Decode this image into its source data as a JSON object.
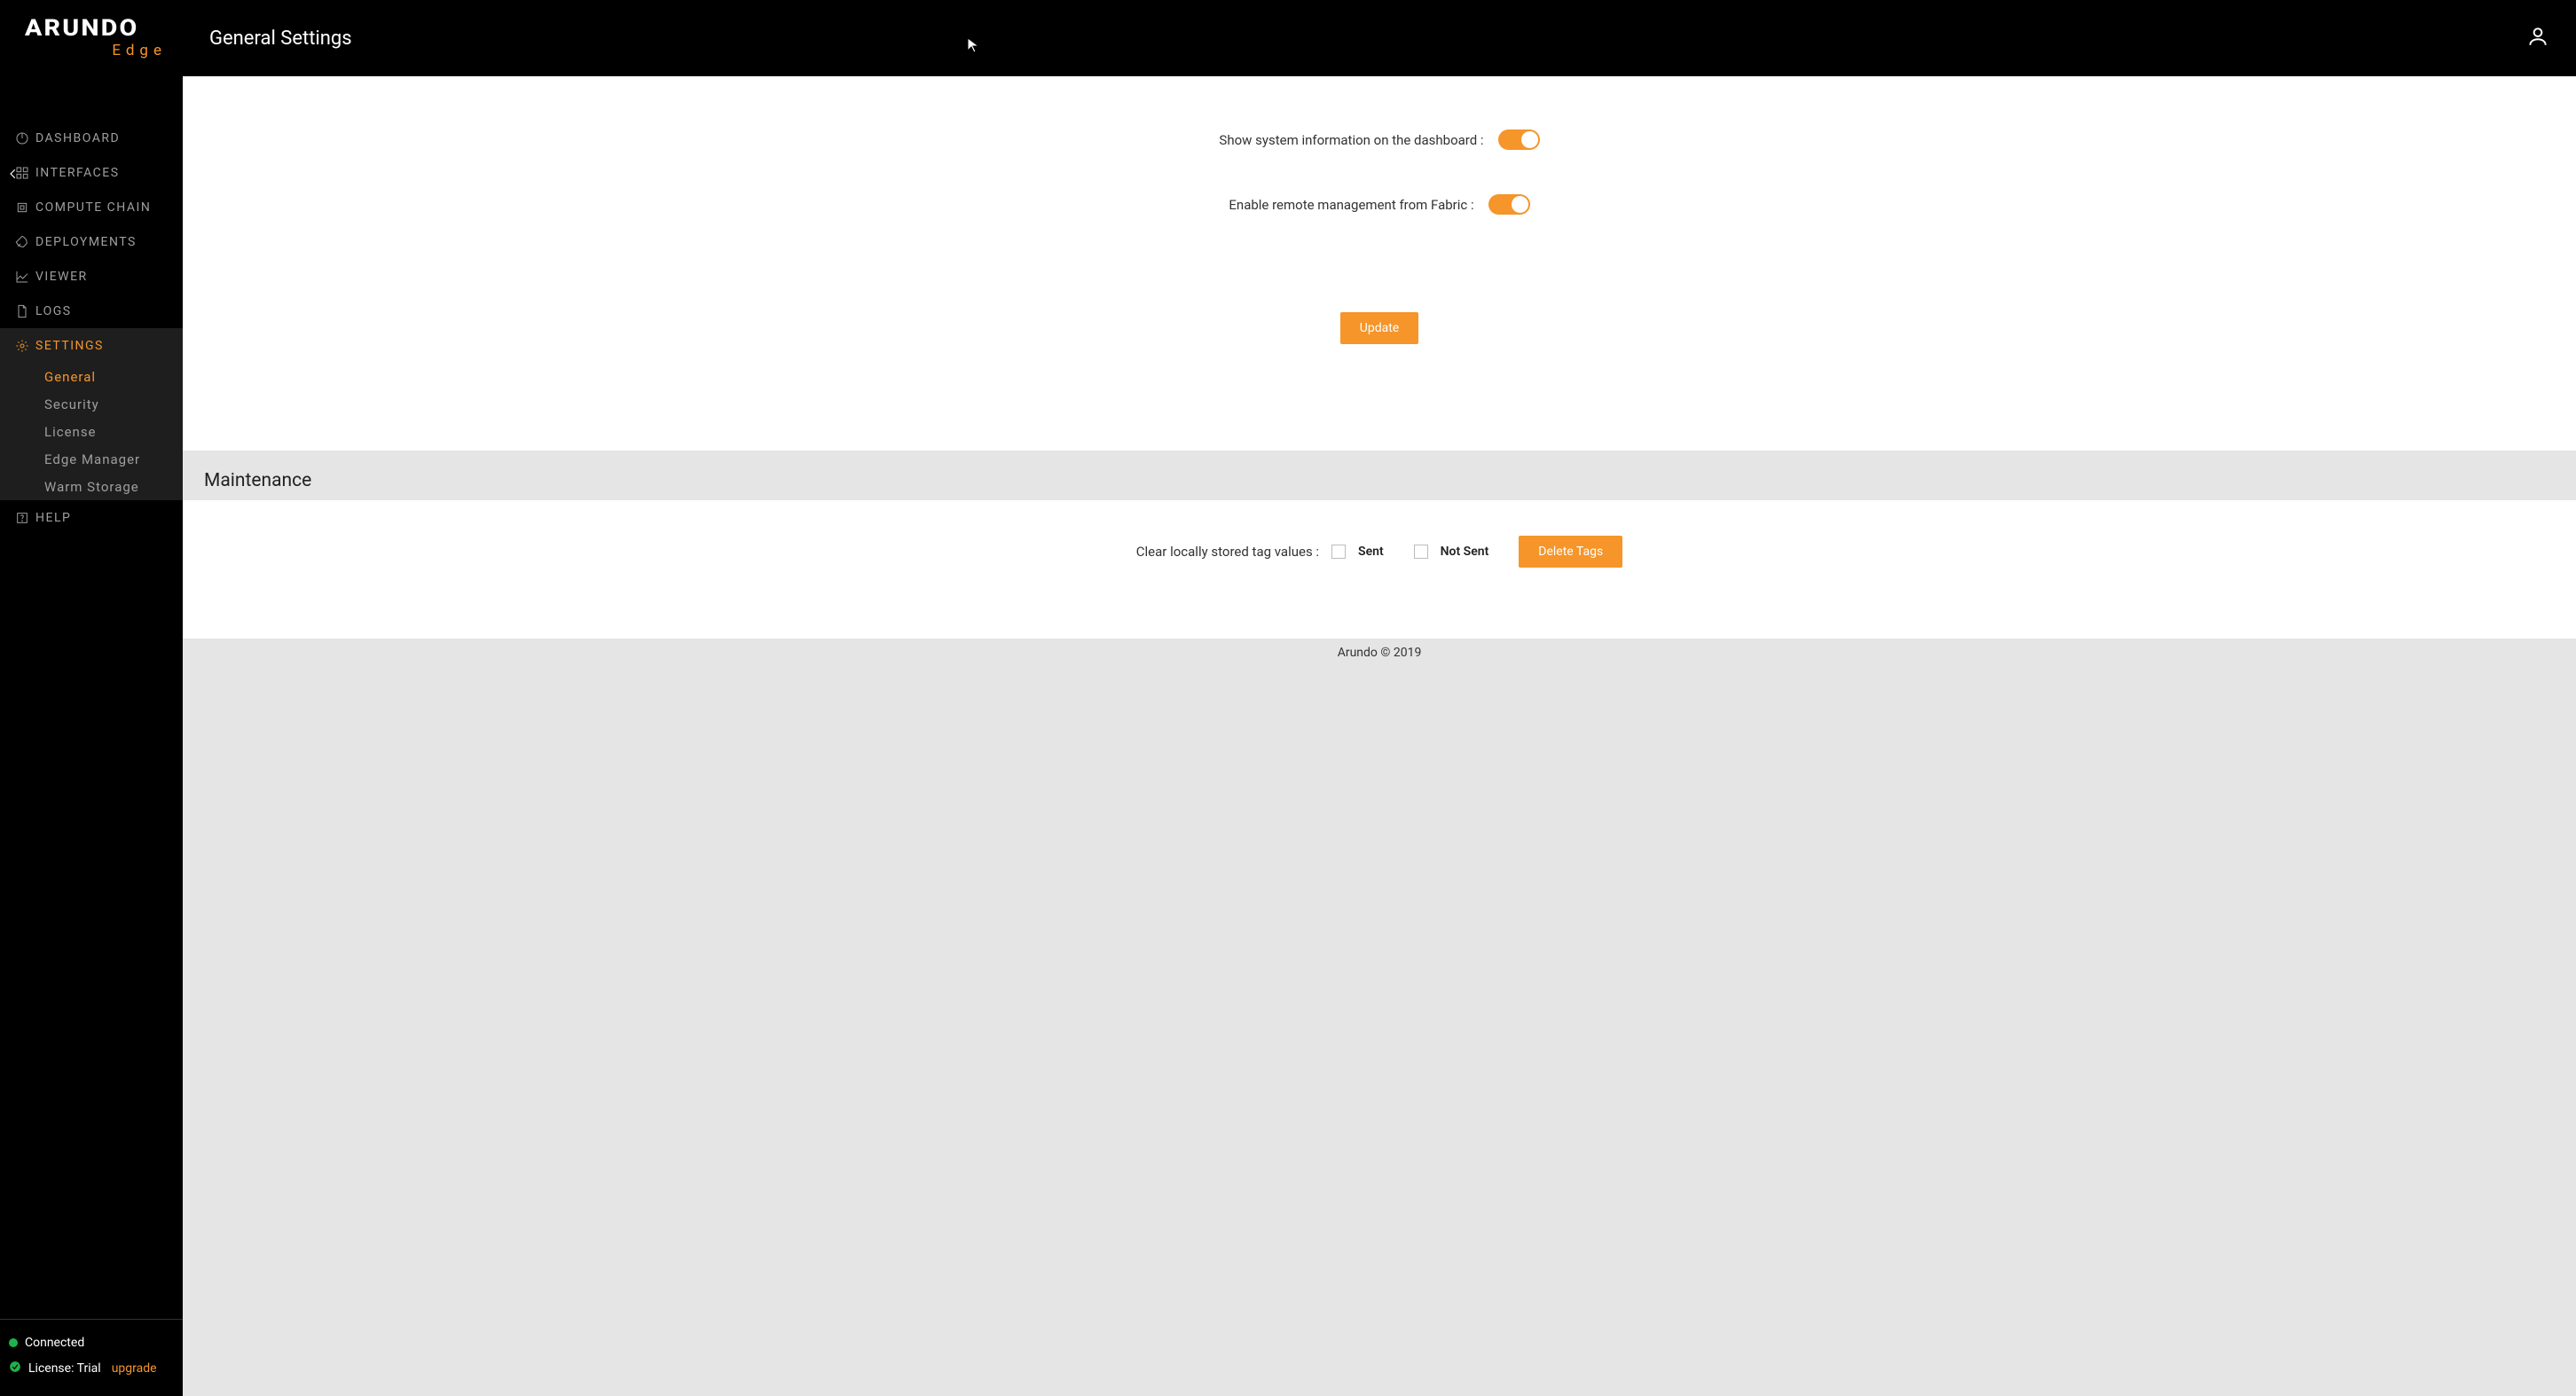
{
  "brand": {
    "name": "ARUNDO",
    "sub": "Edge"
  },
  "header": {
    "title": "General Settings"
  },
  "sidebar": {
    "items": [
      {
        "label": "DASHBOARD"
      },
      {
        "label": "INTERFACES"
      },
      {
        "label": "COMPUTE CHAIN"
      },
      {
        "label": "DEPLOYMENTS"
      },
      {
        "label": "VIEWER"
      },
      {
        "label": "LOGS"
      },
      {
        "label": "SETTINGS"
      },
      {
        "label": "HELP"
      }
    ],
    "settings_sub": [
      {
        "label": "General"
      },
      {
        "label": "Security"
      },
      {
        "label": "License"
      },
      {
        "label": "Edge Manager"
      },
      {
        "label": "Warm Storage"
      }
    ]
  },
  "status": {
    "connected": "Connected",
    "license_prefix": "License: Trial",
    "upgrade": "upgrade"
  },
  "settings": {
    "show_sysinfo_label": "Show system information on the dashboard :",
    "enable_remote_label": "Enable remote management from Fabric :",
    "update_btn": "Update"
  },
  "maintenance": {
    "heading": "Maintenance",
    "clear_label": "Clear locally stored tag values :",
    "sent": "Sent",
    "not_sent": "Not Sent",
    "delete_btn": "Delete Tags"
  },
  "footer": {
    "text": "Arundo © 2019"
  }
}
